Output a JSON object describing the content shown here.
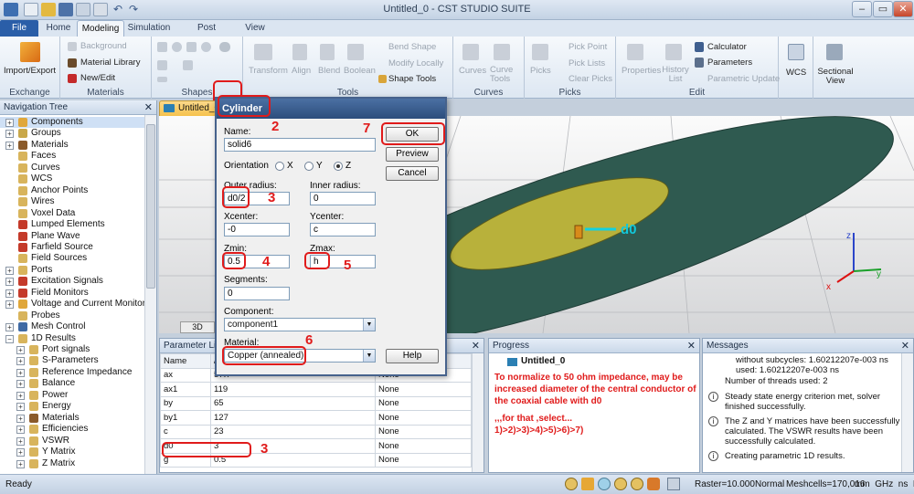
{
  "app": {
    "title": "Untitled_0 - CST STUDIO SUITE"
  },
  "tabs": [
    "File",
    "Home",
    "Modeling",
    "Simulation",
    "Post Processing",
    "View"
  ],
  "ribbon": {
    "exchange": {
      "import_export": "Import/Export",
      "label": "Exchange"
    },
    "materials": {
      "background": "Background",
      "material_library": "Material Library",
      "new_edit": "New/Edit",
      "label": "Materials"
    },
    "shapes": {
      "label": "Shapes"
    },
    "tools": {
      "transform": "Transform",
      "align": "Align",
      "blend": "Blend",
      "boolean": "Boolean",
      "bend_shape": "Bend Shape",
      "modify_locally": "Modify Locally",
      "shape_tools": "Shape Tools",
      "label": "Tools"
    },
    "curves": {
      "curves": "Curves",
      "curve_tools": "Curve Tools",
      "label": "Curves"
    },
    "picks": {
      "picks": "Picks",
      "pick_point": "Pick Point",
      "pick_lists": "Pick Lists",
      "clear_picks": "Clear Picks",
      "label": "Picks"
    },
    "edit": {
      "properties": "Properties",
      "history_list": "History List",
      "calculator": "Calculator",
      "parameters": "Parameters",
      "parametric_update": "Parametric Update",
      "label": "Edit"
    },
    "wcs": {
      "wcs": "WCS",
      "sectional_view": "Sectional View"
    }
  },
  "nav": {
    "title": "Navigation Tree",
    "items": [
      "Components",
      "Groups",
      "Materials",
      "Faces",
      "Curves",
      "WCS",
      "Anchor Points",
      "Wires",
      "Voxel Data",
      "Lumped Elements",
      "Plane Wave",
      "Farfield Source",
      "Field Sources",
      "Ports",
      "Excitation Signals",
      "Field Monitors",
      "Voltage and Current Monitors",
      "Probes",
      "Mesh Control",
      "1D Results",
      "Port signals",
      "S-Parameters",
      "Reference Impedance",
      "Balance",
      "Power",
      "Energy",
      "Materials",
      "Efficiencies",
      "VSWR",
      "Y Matrix",
      "Z Matrix"
    ]
  },
  "viewport": {
    "tab": "Untitled_0",
    "view_mode": "3D",
    "annotation": "d0",
    "axes": {
      "x": "x",
      "y": "y",
      "z": "z"
    }
  },
  "dialog": {
    "title": "Cylinder",
    "name_label": "Name:",
    "name_value": "solid6",
    "orientation_label": "Orientation",
    "orientations": [
      "X",
      "Y",
      "Z"
    ],
    "orientation_selected": "Z",
    "outer_radius_label": "Outer radius:",
    "outer_radius": "d0/2",
    "inner_radius_label": "Inner radius:",
    "inner_radius": "0",
    "xcenter_label": "Xcenter:",
    "xcenter": "-0",
    "ycenter_label": "Ycenter:",
    "ycenter": "c",
    "zmin_label": "Zmin:",
    "zmin": "0.5",
    "zmax_label": "Zmax:",
    "zmax": "h",
    "segments_label": "Segments:",
    "segments": "0",
    "component_label": "Component:",
    "component": "component1",
    "material_label": "Material:",
    "material": "Copper (annealed)",
    "ok": "OK",
    "preview": "Preview",
    "cancel": "Cancel",
    "help": "Help"
  },
  "param_list": {
    "title": "Parameter List",
    "headers": [
      "Name",
      "/"
    ],
    "rows": [
      {
        "name": "ax",
        "value": "57.7",
        "type": "None"
      },
      {
        "name": "ax1",
        "value": "119",
        "type": "None"
      },
      {
        "name": "by",
        "value": "65",
        "type": "None"
      },
      {
        "name": "by1",
        "value": "127",
        "type": "None"
      },
      {
        "name": "c",
        "value": "23",
        "type": "None"
      },
      {
        "name": "d0",
        "value": "3",
        "type": "None"
      },
      {
        "name": "g",
        "value": "0.5",
        "type": "None"
      }
    ]
  },
  "progress": {
    "title": "Progress",
    "item": "Untitled_0",
    "note": "To normalize to 50 ohm impedance, may be increased diameter of the central conductor of the coaxial cable with d0",
    "note2": ",,,for that ,select...",
    "note3": "1)>2)>3)>4)>5)>6)>7)"
  },
  "messages": {
    "title": "Messages",
    "pre_lines": [
      "without subcycles: 1.60212207e-003 ns",
      "used: 1.60212207e-003 ns",
      "Number of threads used: 2"
    ],
    "items": [
      "Steady state energy criterion met, solver finished successfully.",
      "The Z and Y matrices have been successfully calculated. The VSWR results have been successfully calculated.",
      "Creating parametric 1D results."
    ]
  },
  "status": {
    "ready": "Ready",
    "raster": "Raster=10.000",
    "mode": "Normal",
    "meshcells": "Meshcells=170,016",
    "units": "mm  GHz  ns  K"
  },
  "annotations": [
    "1",
    "2",
    "3",
    "4",
    "5",
    "6",
    "7",
    "3"
  ],
  "colors": {
    "annotation": "#e01b1b",
    "file_tab": "#2a5ea8",
    "note_text": "#e01b1b",
    "disk": "#b8b13b",
    "coax": "#2f5a50"
  }
}
